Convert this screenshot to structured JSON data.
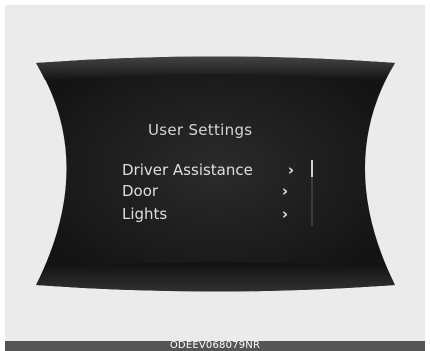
{
  "screen": {
    "title": "User Settings",
    "menu": [
      {
        "label": "Driver Assistance",
        "chevron": "›"
      },
      {
        "label": "Door",
        "chevron": "›"
      },
      {
        "label": "Lights",
        "chevron": "›"
      }
    ],
    "scroll_position": 0.0
  },
  "caption": {
    "code": "ODEEV068079NR"
  },
  "colors": {
    "background": "#ebebeb",
    "panel": "#1b1b1b",
    "text": "#dedede"
  },
  "icons": {
    "chevron": "chevron-right-icon"
  }
}
